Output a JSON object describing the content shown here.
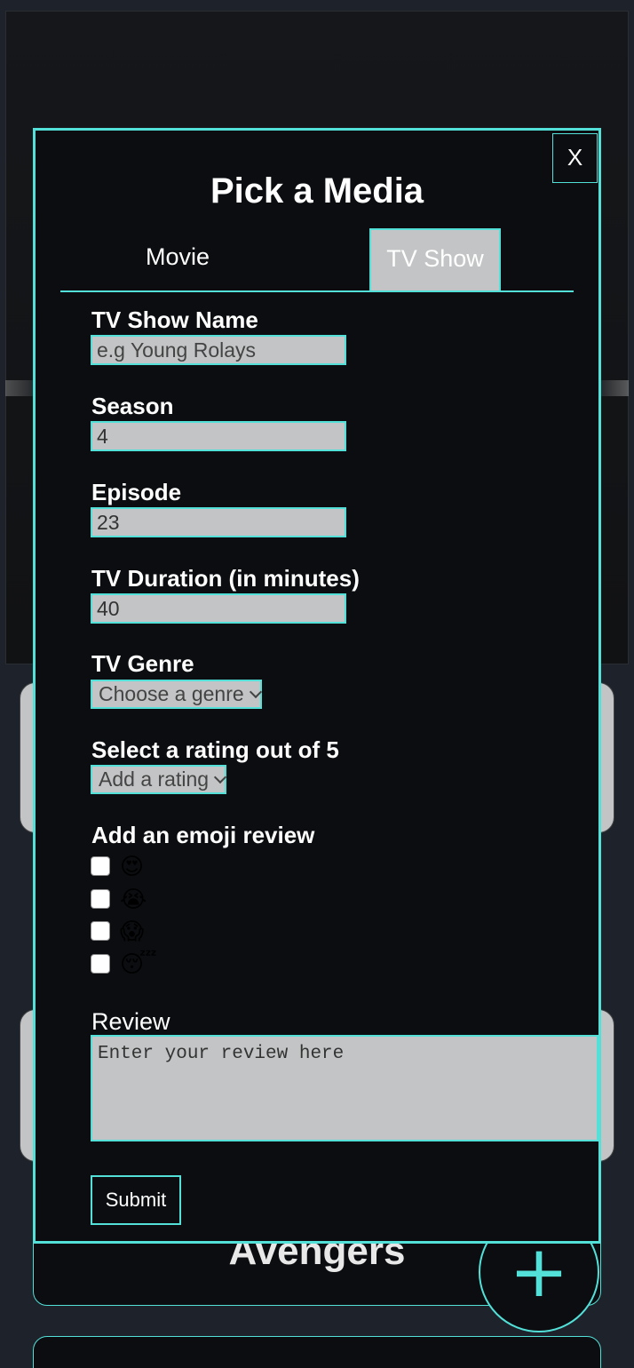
{
  "background": {
    "card_title": "Avengers",
    "add_button_label": "+"
  },
  "modal": {
    "close_label": "X",
    "title": "Pick a Media",
    "tabs": [
      {
        "label": "Movie",
        "active": false
      },
      {
        "label": "TV Show",
        "active": true
      }
    ],
    "fields": {
      "show_name": {
        "label": "TV Show Name",
        "value": "",
        "placeholder": "e.g Young Rolays"
      },
      "season": {
        "label": "Season",
        "value": "4"
      },
      "episode": {
        "label": "Episode",
        "value": "23"
      },
      "duration": {
        "label": "TV Duration (in minutes)",
        "value": "40"
      },
      "genre": {
        "label": "TV Genre",
        "selected": "Choose a genre"
      },
      "rating": {
        "label": "Select a rating out of 5",
        "selected": "Add a rating"
      }
    },
    "emoji_review": {
      "label": "Add an emoji review",
      "options": [
        {
          "emoji": "😍",
          "checked": false
        },
        {
          "emoji": "😭",
          "checked": false
        },
        {
          "emoji": "😱",
          "checked": false
        },
        {
          "emoji": "😴",
          "checked": false
        }
      ]
    },
    "review": {
      "label": "Review",
      "placeholder": "Enter your review here"
    },
    "submit_label": "Submit"
  },
  "colors": {
    "accent": "#52e0d8",
    "modal_bg": "#0b0d10",
    "input_bg": "#c3c4c5",
    "page_bg": "#1e232b"
  }
}
